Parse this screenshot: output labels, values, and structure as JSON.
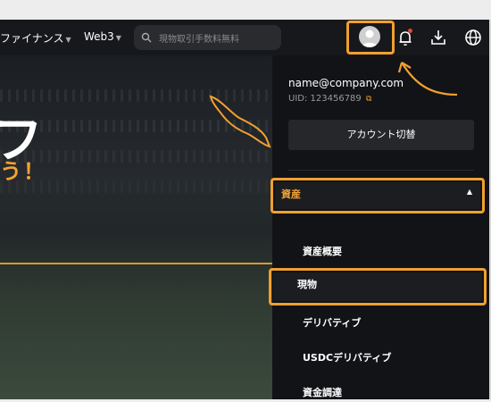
{
  "header": {
    "nav_finance": "ファイナンス",
    "nav_web3": "Web3",
    "search_placeholder": "現物取引手数料無料"
  },
  "hero": {
    "big_text": "フ",
    "sub_text": "う！"
  },
  "account_panel": {
    "email": "name@company.com",
    "uid": "UID: 123456789",
    "switch_button": "アカウント切替",
    "assets_label": "資産",
    "menu": [
      "資産概要",
      "現物",
      "デリバティブ",
      "USDCデリバティブ",
      "資金調達"
    ]
  },
  "icons": {
    "avatar": "user-avatar-icon",
    "notifications": "bell-icon",
    "download": "download-icon",
    "language": "globe-icon"
  },
  "colors": {
    "accent": "#f0a030",
    "background": "#131417",
    "panel": "#121316"
  }
}
